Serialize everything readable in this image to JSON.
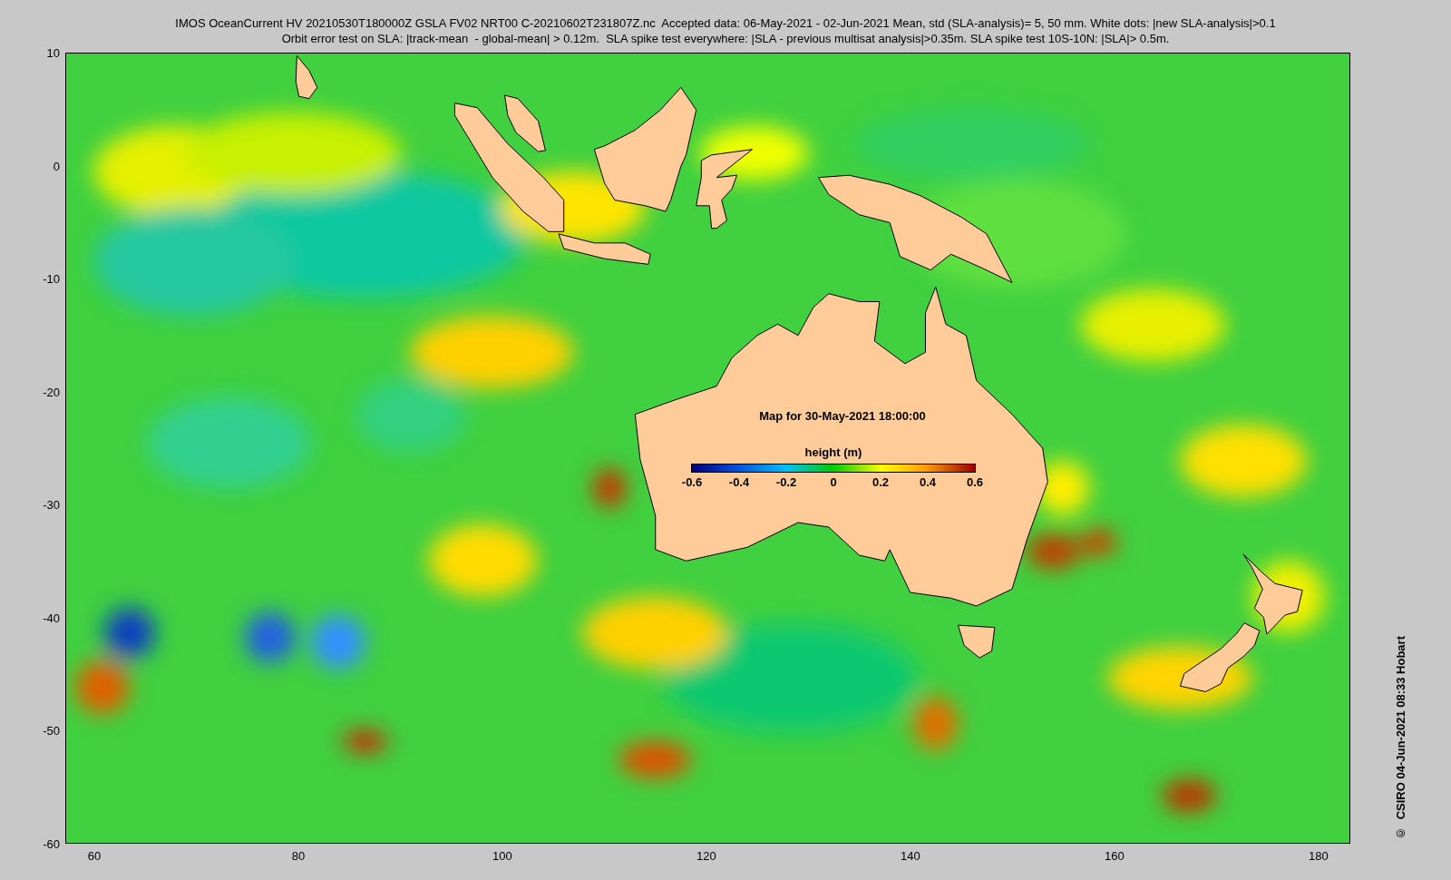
{
  "title_lines": [
    "IMOS OceanCurrent HV 20210530T180000Z GSLA FV02 NRT00 C-20210602T231807Z.nc  Accepted data: 06-May-2021 - 02-Jun-2021 Mean, std (SLA-analysis)= 5, 50 mm. White dots: |new SLA-analysis|>0.1",
    "Orbit error test on SLA: |track-mean  - global-mean| > 0.12m.  SLA spike test everywhere: |SLA - previous multisat analysis|>0.35m. SLA spike test 10S-10N: |SLA|> 0.5m."
  ],
  "map": {
    "caption": "Map for 30-May-2021 18:00:00",
    "colorbar": {
      "title": "height (m)",
      "ticks": [
        "-0.6",
        "-0.4",
        "-0.2",
        "0",
        "0.2",
        "0.4",
        "0.6"
      ]
    }
  },
  "y_axis": {
    "ticks": [
      "10",
      "0",
      "-10",
      "-20",
      "-30",
      "-40",
      "-50",
      "-60"
    ]
  },
  "x_axis": {
    "ticks": [
      "60",
      "80",
      "100",
      "120",
      "140",
      "160",
      "180"
    ]
  },
  "credit": "©  CSIRO 04-Jun-2021 08:33 Hobart"
}
